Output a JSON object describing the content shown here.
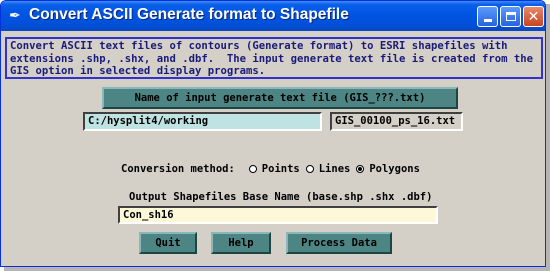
{
  "window": {
    "title": "Convert ASCII Generate format to Shapefile"
  },
  "description": "Convert ASCII text files of contours (Generate format) to ESRI shapefiles with\nextensions .shp, .shx, and .dbf.  The input generate text file is created from the\nGIS option in selected display programs.",
  "input": {
    "name_button_label": "Name of input generate text file (GIS_???.txt)",
    "directory_value": "C:/hysplit4/working",
    "file_value": "GIS_00100_ps_16.txt"
  },
  "conversion": {
    "label": "Conversion method:",
    "options": [
      {
        "label": "Points",
        "checked": false
      },
      {
        "label": "Lines",
        "checked": false
      },
      {
        "label": "Polygons",
        "checked": true
      }
    ]
  },
  "output": {
    "label": "Output Shapefiles Base Name (base.shp .shx .dbf)",
    "value": "Con_sh16"
  },
  "buttons": {
    "quit": "Quit",
    "help": "Help",
    "process": "Process Data"
  },
  "icons": {
    "app": "feather-icon",
    "minimize": "minimize-icon",
    "maximize": "maximize-icon",
    "close": "close-icon"
  },
  "colors": {
    "titlebar": "#0054e3",
    "button_teal": "#4d8585",
    "description_text": "#1a1a7a",
    "description_border": "#3333cc",
    "dir_field": "#bfe3e3",
    "output_field": "#fdf8d8",
    "panel": "#d4d0c8"
  }
}
